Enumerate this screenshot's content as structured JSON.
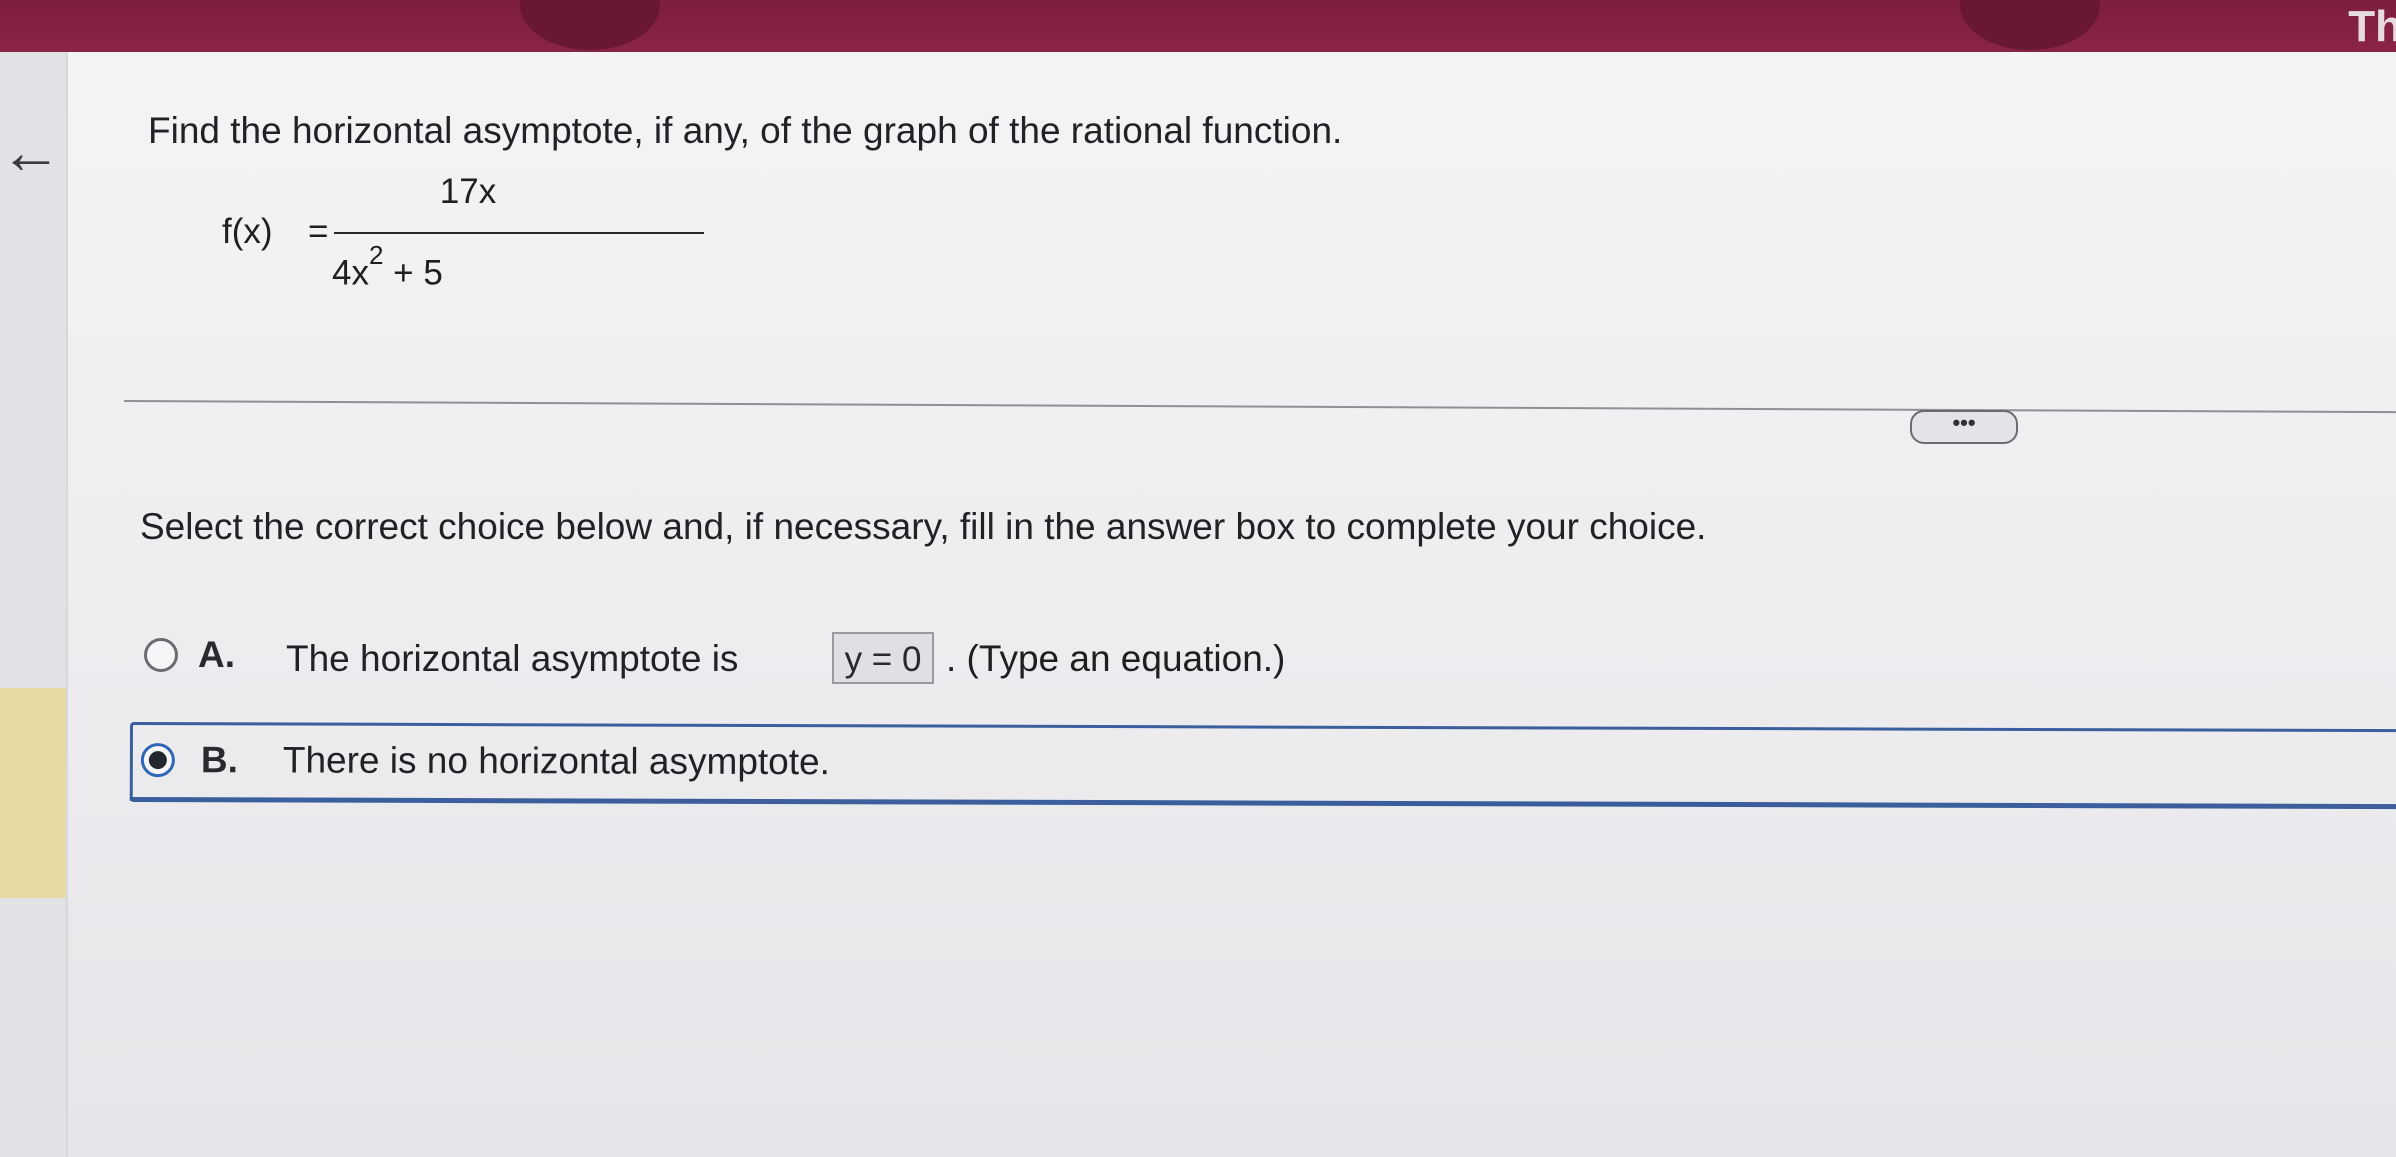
{
  "header": {
    "corner_text": "Th",
    "colors": {
      "banner": "#7c1e3c"
    }
  },
  "nav": {
    "back_icon": "arrow-left-icon",
    "back_glyph": "←"
  },
  "question": {
    "prompt": "Find the horizontal asymptote, if any, of the graph of the rational function.",
    "formula": {
      "lhs": "f(x)",
      "equals": "=",
      "numerator": "17x",
      "denominator_base": "4x",
      "denominator_exponent": "2",
      "denominator_rest": " + 5"
    }
  },
  "more_button": {
    "label": "•••"
  },
  "instruction": "Select the correct choice below and, if necessary, fill in the answer box to complete your choice.",
  "choices": [
    {
      "letter": "A.",
      "text_before": "The horizontal asymptote is",
      "answer_value": "y = 0",
      "text_after": ". (Type an equation.)",
      "selected": false
    },
    {
      "letter": "B.",
      "text": "There is no horizontal asymptote.",
      "selected": true
    }
  ],
  "colors": {
    "selection": "#3b5f9c",
    "left_tab": "#e6d9a4"
  }
}
